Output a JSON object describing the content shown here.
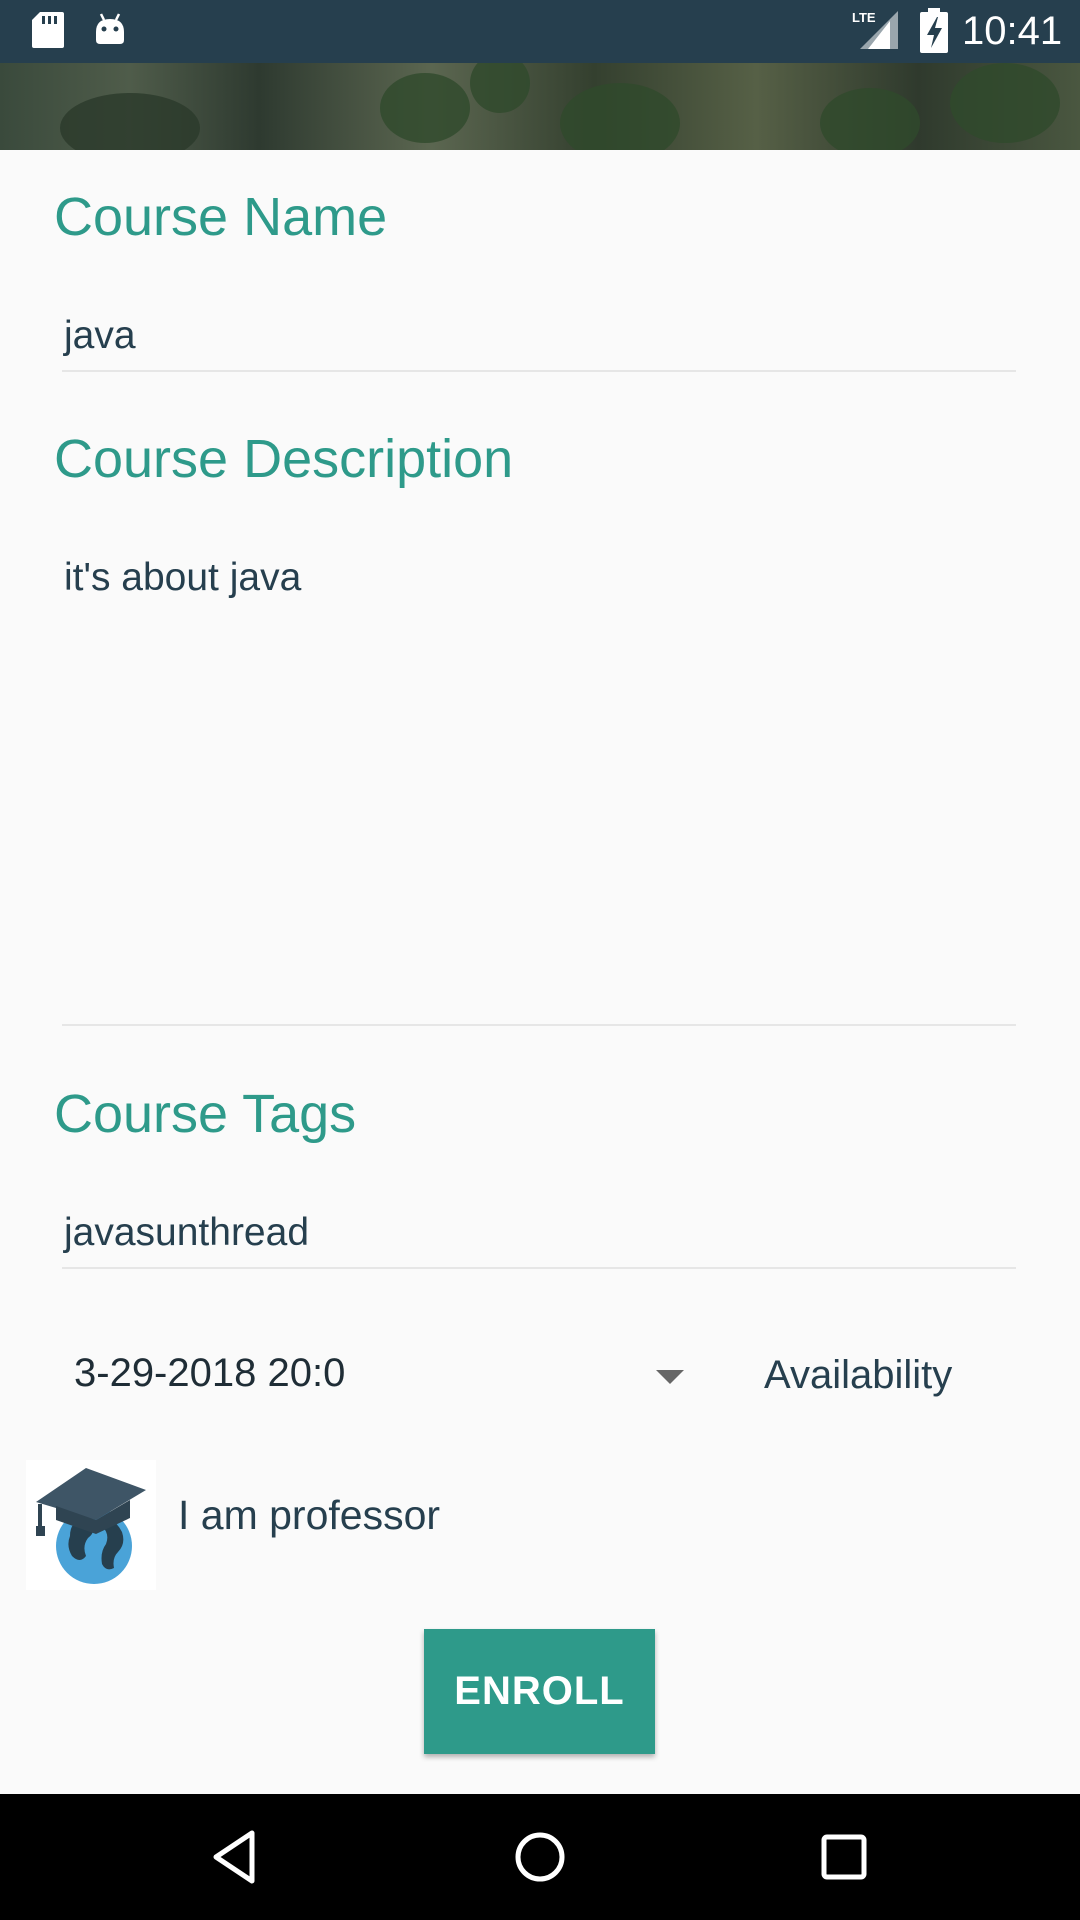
{
  "status_bar": {
    "time": "10:41",
    "network_label": "LTE",
    "icons": [
      "sd-card-icon",
      "android-icon",
      "lte-signal-icon",
      "battery-charging-icon"
    ]
  },
  "form": {
    "course_name": {
      "label": "Course Name",
      "value": "java"
    },
    "course_description": {
      "label": "Course Description",
      "value": "it's about java"
    },
    "course_tags": {
      "label": "Course Tags",
      "value": "javasunthread"
    },
    "date": {
      "selected": "3-29-2018 20:0"
    },
    "availability_label": "Availability",
    "professor": {
      "label": "I am professor",
      "icon": "graduation-globe-icon"
    },
    "enroll_label": "ENROLL"
  },
  "nav_bar": {
    "icons": [
      "back-icon",
      "home-icon",
      "recents-icon"
    ]
  },
  "colors": {
    "accent": "#2e9a8a",
    "status_bar": "#263f4e",
    "text": "#263f4e",
    "background": "#fafafa"
  }
}
